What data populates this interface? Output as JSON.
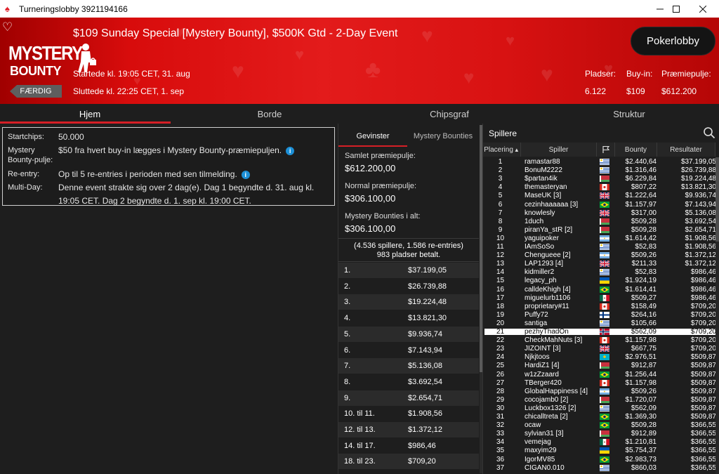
{
  "window": {
    "title": "Turneringslobby 3921194166",
    "icon": "pokerstars-spade-icon"
  },
  "banner": {
    "logo_line1": "MYSTERY",
    "logo_line2": "BOUNTY",
    "event_title": "$109 Sunday Special [Mystery Bounty], $500K Gtd - 2-Day Event",
    "started": "Startede kl. 19:05 CET, 31. aug",
    "ended": "Sluttede kl. 22:25 CET, 1. sep",
    "status": "FÆRDIG",
    "lobby_button": "Pokerlobby",
    "stats": [
      {
        "label": "Pladser:",
        "value": "6.122"
      },
      {
        "label": "Buy-in:",
        "value": "$109"
      },
      {
        "label": "Præmiepulje:",
        "value": "$612.200"
      }
    ]
  },
  "tabs": [
    "Hjem",
    "Borde",
    "Chipsgraf",
    "Struktur"
  ],
  "info": {
    "startchips_label": "Startchips:",
    "startchips_value": "50.000",
    "mystery_label_1": "Mystery",
    "mystery_label_2": "Bounty-pulje:",
    "mystery_value": "$50 fra hvert buy-in lægges i Mystery Bounty-præmiepuljen.",
    "reentry_label": "Re-entry:",
    "reentry_value": "Op til 5 re-entries i perioden med sen tilmelding.",
    "multiday_label": "Multi-Day:",
    "multiday_value": "Denne event strakte sig over 2 dag(e). Dag 1 begyndte d. 31. aug kl. 19:05 CET. Dag 2 begyndte d. 1. sep kl. 19:00 CET."
  },
  "prizes": {
    "tab_winners": "Gevinster",
    "tab_bounties": "Mystery Bounties",
    "total_label": "Samlet præmiepulje:",
    "total_value": "$612.200,00",
    "normal_label": "Normal præmiepulje:",
    "normal_value": "$306.100,00",
    "bounties_label": "Mystery Bounties i alt:",
    "bounties_value": "$306.100,00",
    "players_line": "(4.536 spillere, 1.586 re-entries)",
    "paid_line": "983 pladser betalt.",
    "payouts": [
      {
        "place": "1.",
        "amount": "$37.199,05"
      },
      {
        "place": "2.",
        "amount": "$26.739,88"
      },
      {
        "place": "3.",
        "amount": "$19.224,48"
      },
      {
        "place": "4.",
        "amount": "$13.821,30"
      },
      {
        "place": "5.",
        "amount": "$9.936,74"
      },
      {
        "place": "6.",
        "amount": "$7.143,94"
      },
      {
        "place": "7.",
        "amount": "$5.136,08"
      },
      {
        "place": "8.",
        "amount": "$3.692,54"
      },
      {
        "place": "9.",
        "amount": "$2.654,71"
      },
      {
        "place": "10. til 11.",
        "amount": "$1.908,56"
      },
      {
        "place": "12. til 13.",
        "amount": "$1.372,12"
      },
      {
        "place": "14. til 17.",
        "amount": "$986,46"
      },
      {
        "place": "18. til 23.",
        "amount": "$709,20"
      }
    ]
  },
  "players": {
    "title": "Spillere",
    "headers": {
      "rank": "Placering",
      "player": "Spiller",
      "bounty": "Bounty",
      "result": "Resultater"
    },
    "highlight_color": "#ffffff",
    "rows": [
      {
        "rank": "1",
        "name": "ramastar88",
        "flag": "uruguay",
        "bounty": "$2.440,64",
        "result": "$37.199,05"
      },
      {
        "rank": "2",
        "name": "BonuM2222",
        "flag": "uruguay",
        "bounty": "$1.316,46",
        "result": "$26.739,88"
      },
      {
        "rank": "3",
        "name": "$partan4ik",
        "flag": "belarus",
        "bounty": "$6.229,84",
        "result": "$19.224,48"
      },
      {
        "rank": "4",
        "name": "themasteryan",
        "flag": "canada",
        "bounty": "$807,22",
        "result": "$13.821,30"
      },
      {
        "rank": "5",
        "name": "MaseUK [3]",
        "flag": "uk",
        "bounty": "$1.222,64",
        "result": "$9.936,74"
      },
      {
        "rank": "6",
        "name": "cezinhaaaaaa [3]",
        "flag": "brazil",
        "bounty": "$1.157,97",
        "result": "$7.143,94"
      },
      {
        "rank": "7",
        "name": "knowlesly",
        "flag": "uk",
        "bounty": "$317,00",
        "result": "$5.136,08"
      },
      {
        "rank": "8",
        "name": "1duch",
        "flag": "belarus",
        "bounty": "$509,28",
        "result": "$3.692,54"
      },
      {
        "rank": "9",
        "name": "piranYa_stR [2]",
        "flag": "belarus",
        "bounty": "$509,28",
        "result": "$2.654,71"
      },
      {
        "rank": "10",
        "name": "yaguipoker",
        "flag": "argentina",
        "bounty": "$1.614,42",
        "result": "$1.908,56"
      },
      {
        "rank": "11",
        "name": "IAmSoSo",
        "flag": "uruguay",
        "bounty": "$52,83",
        "result": "$1.908,56"
      },
      {
        "rank": "12",
        "name": "Chengueee [2]",
        "flag": "argentina",
        "bounty": "$509,26",
        "result": "$1.372,12"
      },
      {
        "rank": "13",
        "name": "LAP1293 [4]",
        "flag": "uk",
        "bounty": "$211,33",
        "result": "$1.372,12"
      },
      {
        "rank": "14",
        "name": "kidmiller2",
        "flag": "uruguay",
        "bounty": "$52,83",
        "result": "$986,46"
      },
      {
        "rank": "15",
        "name": "legacy_ph",
        "flag": "ukraine",
        "bounty": "$1.924,19",
        "result": "$986,46"
      },
      {
        "rank": "16",
        "name": "calldeKhigh [4]",
        "flag": "brazil",
        "bounty": "$1.614,41",
        "result": "$986,46"
      },
      {
        "rank": "17",
        "name": "miguelurb1106",
        "flag": "mexico",
        "bounty": "$509,27",
        "result": "$986,46"
      },
      {
        "rank": "18",
        "name": "proprietary#11",
        "flag": "canada",
        "bounty": "$158,49",
        "result": "$709,20"
      },
      {
        "rank": "19",
        "name": "Puffy72",
        "flag": "finland",
        "bounty": "$264,16",
        "result": "$709,20"
      },
      {
        "rank": "20",
        "name": "santiga",
        "flag": "uruguay",
        "bounty": "$105,66",
        "result": "$709,20"
      },
      {
        "rank": "21",
        "name": "pezhyThadOn",
        "flag": "norway",
        "bounty": "$562,09",
        "result": "$709,20"
      },
      {
        "rank": "22",
        "name": "CheckMahNuts [3]",
        "flag": "canada",
        "bounty": "$1.157,98",
        "result": "$709,20"
      },
      {
        "rank": "23",
        "name": "JIZOINT [3]",
        "flag": "uk",
        "bounty": "$667,75",
        "result": "$709,20"
      },
      {
        "rank": "24",
        "name": "Njkjtoos",
        "flag": "kazakhstan",
        "bounty": "$2.976,51",
        "result": "$509,87"
      },
      {
        "rank": "25",
        "name": "HardiZ1 [4]",
        "flag": "belarus",
        "bounty": "$912,87",
        "result": "$509,87"
      },
      {
        "rank": "26",
        "name": "w1zZzaard",
        "flag": "brazil",
        "bounty": "$1.256,44",
        "result": "$509,87"
      },
      {
        "rank": "27",
        "name": "TBerger420",
        "flag": "canada",
        "bounty": "$1.157,98",
        "result": "$509,87"
      },
      {
        "rank": "28",
        "name": "GlobalHappiness [4]",
        "flag": "argentina",
        "bounty": "$509,26",
        "result": "$509,87"
      },
      {
        "rank": "29",
        "name": "cocojamb0 [2]",
        "flag": "belarus",
        "bounty": "$1.720,07",
        "result": "$509,87"
      },
      {
        "rank": "30",
        "name": "Luckbox1326 [2]",
        "flag": "uruguay",
        "bounty": "$562,09",
        "result": "$509,87"
      },
      {
        "rank": "31",
        "name": "chicalltreta [2]",
        "flag": "brazil",
        "bounty": "$1.369,30",
        "result": "$509,87"
      },
      {
        "rank": "32",
        "name": "ocaw",
        "flag": "brazil",
        "bounty": "$509,28",
        "result": "$366,55"
      },
      {
        "rank": "33",
        "name": "sylvian31 [3]",
        "flag": "belarus",
        "bounty": "$912,89",
        "result": "$366,55"
      },
      {
        "rank": "34",
        "name": "vemejag",
        "flag": "mexico",
        "bounty": "$1.210,81",
        "result": "$366,55"
      },
      {
        "rank": "35",
        "name": "maxyim29",
        "flag": "ukraine",
        "bounty": "$5.754,37",
        "result": "$366,55"
      },
      {
        "rank": "36",
        "name": "IgorMV85",
        "flag": "brazil",
        "bounty": "$2.983,73",
        "result": "$366,55"
      },
      {
        "rank": "37",
        "name": "CIGAN0.010",
        "flag": "uruguay",
        "bounty": "$860,03",
        "result": "$366,55"
      }
    ]
  }
}
